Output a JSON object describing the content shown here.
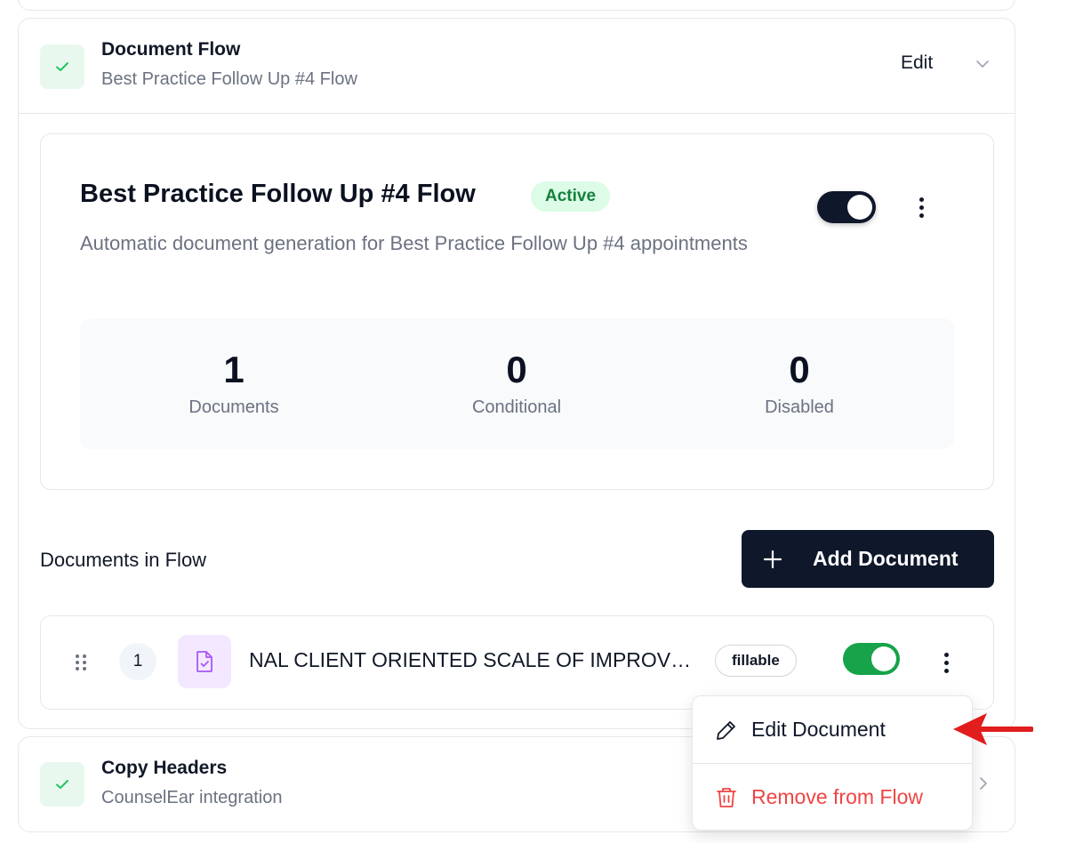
{
  "document_flow": {
    "title": "Document Flow",
    "subtitle": "Best Practice Follow Up #4 Flow",
    "edit_label": "Edit"
  },
  "flow_details": {
    "title": "Best Practice Follow Up #4 Flow",
    "status": "Active",
    "description": "Automatic document generation for Best Practice Follow Up #4 appointments",
    "enabled": true,
    "stats": [
      {
        "value": "1",
        "label": "Documents"
      },
      {
        "value": "0",
        "label": "Conditional"
      },
      {
        "value": "0",
        "label": "Disabled"
      }
    ]
  },
  "documents": {
    "section_label": "Documents in Flow",
    "add_label": "Add Document",
    "items": [
      {
        "index": "1",
        "name": "NAL CLIENT ORIENTED SCALE OF IMPROVEMENT",
        "tag": "fillable",
        "enabled": true
      }
    ]
  },
  "context_menu": {
    "edit_label": "Edit Document",
    "remove_label": "Remove from Flow"
  },
  "copy_headers": {
    "title": "Copy Headers",
    "subtitle": "CounselEar integration"
  },
  "colors": {
    "primary_dark": "#0f172a",
    "success": "#16a34a",
    "danger": "#ef4444",
    "annotation_arrow": "#e11d1d"
  }
}
